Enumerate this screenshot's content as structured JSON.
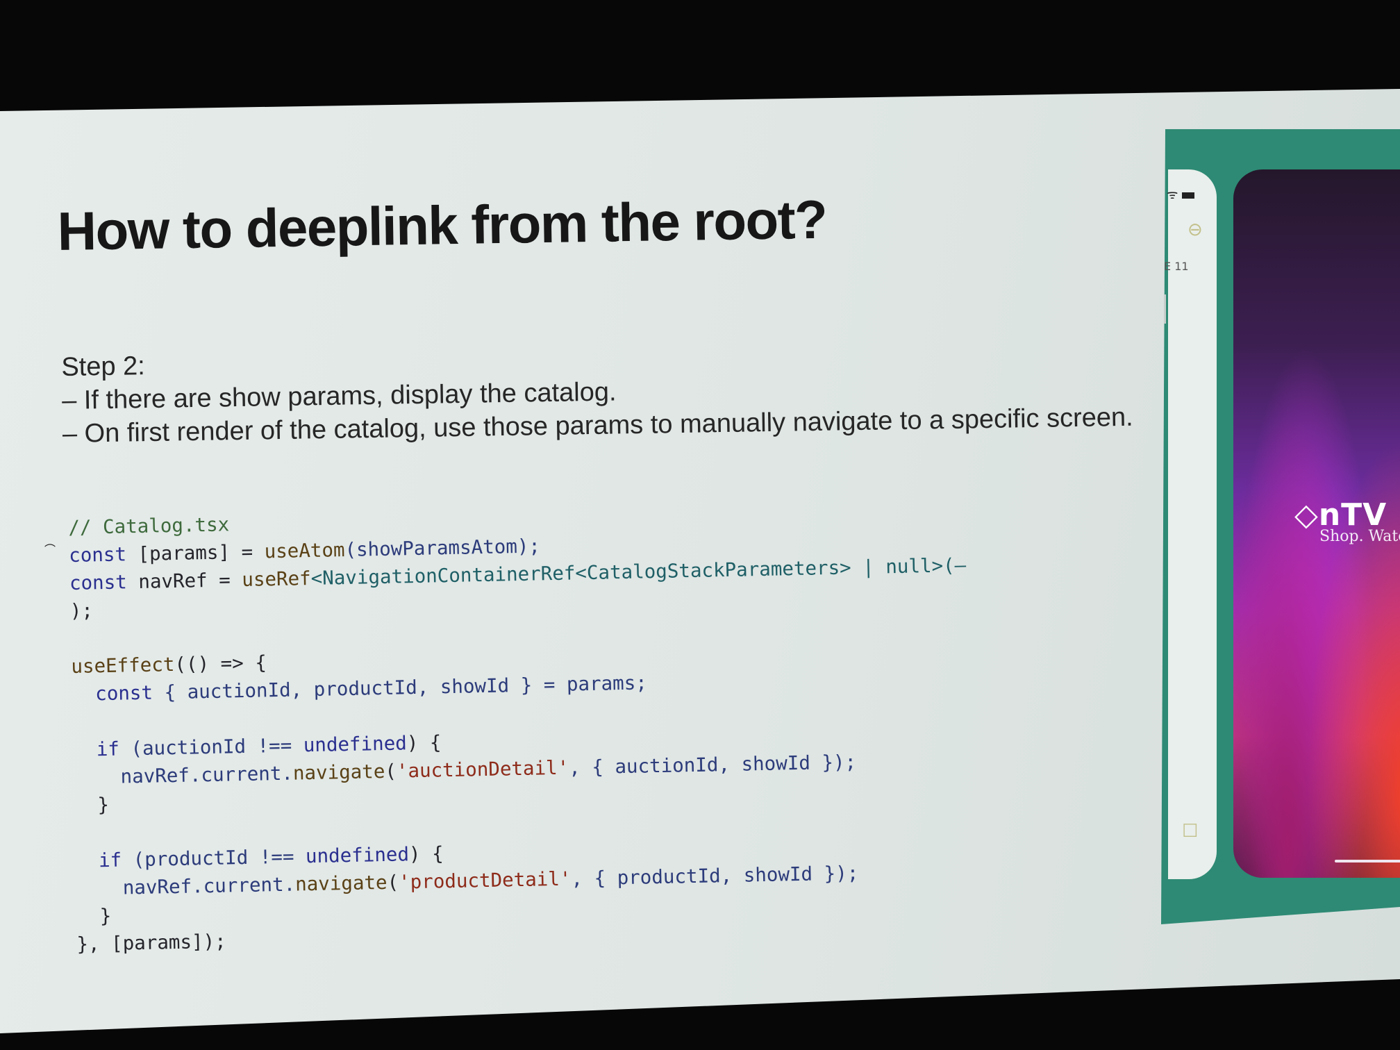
{
  "slide": {
    "title": "How to deeplink from the root?",
    "step_heading": "Step 2:",
    "bullets": [
      "– If there are show params, display the catalog.",
      "– On first render of the catalog, use those params to manually navigate to a specific screen."
    ]
  },
  "code": {
    "filename_comment": "// Catalog.tsx",
    "line_params": {
      "kw": "const",
      "rest": " [params] = ",
      "fn": "useAtom",
      "arg": "(showParamsAtom);"
    },
    "line_navref": {
      "kw": "const",
      "rest": " navRef = ",
      "fn": "useRef",
      "generic": "<NavigationContainerRef<CatalogStackParameters> | null>(–"
    },
    "line_close": ");",
    "line_useeffect": {
      "fn": "useEffect",
      "rest": "(() => {"
    },
    "line_destructure": {
      "kw": "const",
      "rest": " { auctionId, productId, showId } = params;"
    },
    "if_auction": {
      "kw": "if",
      "cond": " (auctionId !== ",
      "undef": "undefined",
      "tail": ") {"
    },
    "nav_auction": {
      "obj": "navRef.current.",
      "fn": "navigate",
      "open": "(",
      "str": "'auctionDetail'",
      "args": ", { auctionId, showId });"
    },
    "close_brace": "}",
    "if_product": {
      "kw": "if",
      "cond": " (productId !== ",
      "undef": "undefined",
      "tail": ") {"
    },
    "nav_product": {
      "obj": "navRef.current.",
      "fn": "navigate",
      "open": "(",
      "str": "'productDetail'",
      "args": ", { productId, showId });"
    },
    "line_end": "}, [params]);"
  },
  "phone": {
    "logo_text": "◇nTV",
    "tagline": "Shop. Watch",
    "side_label": "E 11",
    "colors": {
      "frame": "#2e8a74",
      "screen_top": "#24172b",
      "screen_mid": "#a52fb5",
      "screen_bottom_accent": "#f2402a"
    }
  }
}
